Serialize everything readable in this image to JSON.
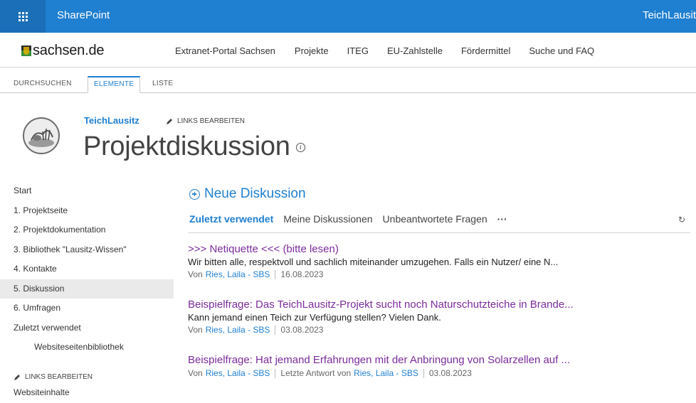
{
  "suitebar": {
    "brand": "SharePoint",
    "site_right": "TeichLausit"
  },
  "topnav": {
    "logo_text": "sachsen.de",
    "links": [
      "Extranet-Portal Sachsen",
      "Projekte",
      "ITEG",
      "EU-Zahlstelle",
      "Fördermittel",
      "Suche und FAQ"
    ]
  },
  "ribbon": {
    "tabs": [
      "DURCHSUCHEN",
      "ELEMENTE",
      "LISTE"
    ],
    "active": "ELEMENTE"
  },
  "title_area": {
    "breadcrumb": "TeichLausitz",
    "edit_links": "LINKS BEARBEITEN",
    "page_title": "Projektdiskussion",
    "info_icon": "i"
  },
  "leftnav": {
    "items": [
      "Start",
      "1. Projektseite",
      "2. Projektdokumentation",
      "3. Bibliothek \"Lausitz-Wissen\"",
      "4. Kontakte",
      "5. Diskussion",
      "6. Umfragen",
      "Zuletzt verwendet",
      "Websiteseitenbibliothek"
    ],
    "selected": "5. Diskussion",
    "edit_links": "LINKS BEARBEITEN",
    "site_contents": "Websiteinhalte"
  },
  "main": {
    "new_discussion": "Neue Diskussion",
    "pivots": [
      "Zuletzt verwendet",
      "Meine Diskussionen",
      "Unbeantwortete Fragen",
      "···"
    ],
    "active_pivot": "Zuletzt verwendet",
    "refresh_icon": "↻",
    "discussions": [
      {
        "title": ">>> Netiquette <<< (bitte lesen)",
        "body": "Wir bitten alle, respektvoll und sachlich miteinander umzugehen. Falls ein Nutzer/ eine N...",
        "by": "Von",
        "author": "Ries, Laila - SBS",
        "date": "16.08.2023"
      },
      {
        "title": "Beispielfrage: Das TeichLausitz-Projekt sucht noch Naturschutzteiche in Brande...",
        "body": "Kann jemand einen Teich zur Verfügung stellen? Vielen Dank.",
        "by": "Von",
        "author": "Ries, Laila - SBS",
        "date": "03.08.2023"
      },
      {
        "title": "Beispielfrage: Hat jemand Erfahrungen mit der Anbringung von Solarzellen auf ...",
        "by": "Von",
        "author": "Ries, Laila - SBS",
        "last_reply_label": "Letzte Antwort von",
        "last_reply_author": "Ries, Laila - SBS",
        "date": "03.08.2023"
      }
    ]
  },
  "colors": {
    "suitebar": "#1f7fd0",
    "accent": "#1f7fd0",
    "discussion_title": "#7b2c9c"
  }
}
